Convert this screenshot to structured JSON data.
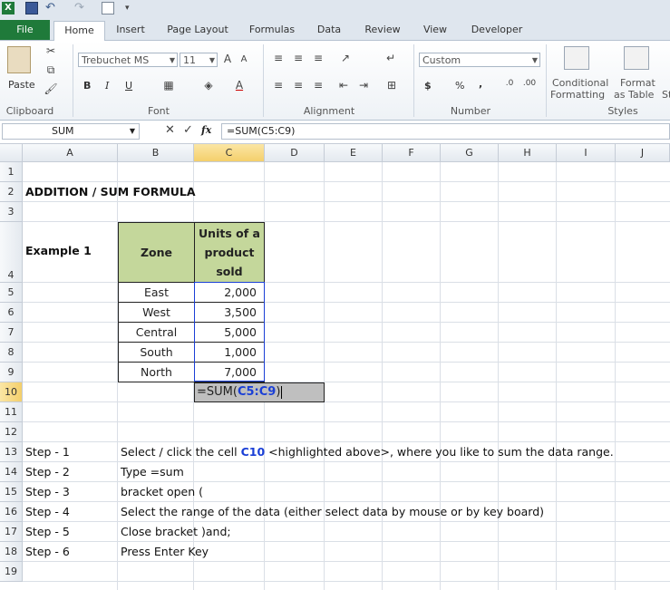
{
  "ribbon_tabs": [
    "File",
    "Home",
    "Insert",
    "Page Layout",
    "Formulas",
    "Data",
    "Review",
    "View",
    "Developer"
  ],
  "ribbon": {
    "clipboard": {
      "label": "Clipboard",
      "paste": "Paste"
    },
    "font": {
      "label": "Font",
      "name": "Trebuchet MS",
      "size": "11",
      "bold": "B",
      "italic": "I",
      "underline": "U"
    },
    "alignment": {
      "label": "Alignment"
    },
    "number": {
      "label": "Number",
      "format": "Custom",
      "currency": "$",
      "percent": "%",
      "comma": ","
    },
    "styles": {
      "label": "Styles",
      "conditional": "Conditional",
      "conditional2": "Formatting",
      "format_as": "Format",
      "format_as2": "as Table",
      "cell_styles": "St"
    }
  },
  "formula_bar": {
    "name_box": "SUM",
    "fx": "fx",
    "formula": "=SUM(C5:C9)"
  },
  "columns": [
    "A",
    "B",
    "C",
    "D",
    "E",
    "F",
    "G",
    "H",
    "I",
    "J"
  ],
  "rows": [
    "1",
    "2",
    "3",
    "4",
    "5",
    "6",
    "7",
    "8",
    "9",
    "10",
    "11",
    "12",
    "13",
    "14",
    "15",
    "16",
    "17",
    "18",
    "19"
  ],
  "sheet": {
    "title": "ADDITION / SUM FORMULA",
    "example": "Example 1",
    "table": {
      "header_zone": "Zone",
      "header_units": "Units of a product sold",
      "header_units_l1": "Units of a",
      "header_units_l2": "product",
      "header_units_l3": "sold",
      "rows": [
        {
          "zone": "East",
          "units": "2,000"
        },
        {
          "zone": "West",
          "units": "3,500"
        },
        {
          "zone": "Central",
          "units": "5,000"
        },
        {
          "zone": "South",
          "units": "1,000"
        },
        {
          "zone": "North",
          "units": "7,000"
        }
      ]
    },
    "edit_cell": {
      "prefix": "=SUM(",
      "ref": "C5:C9",
      "suffix": ")"
    },
    "steps": [
      {
        "step": "Step - 1",
        "text_a": "Select / click the cell ",
        "text_ref": "C10",
        "text_b": " <highlighted above>, where you like to sum the data range."
      },
      {
        "step": "Step - 2",
        "text": "Type =sum"
      },
      {
        "step": "Step - 3",
        "text": "bracket open ("
      },
      {
        "step": "Step - 4",
        "text": "Select the range of the data (either select data by mouse or by key board)"
      },
      {
        "step": "Step - 5",
        "text": "Close bracket )and;"
      },
      {
        "step": "Step - 6",
        "text": "Press Enter Key"
      }
    ]
  },
  "colors": {
    "file_tab": "#1f7a3a",
    "table_header": "#c4d79b",
    "range_ref": "#1a3fd6",
    "selection": "#f4cf6b"
  }
}
